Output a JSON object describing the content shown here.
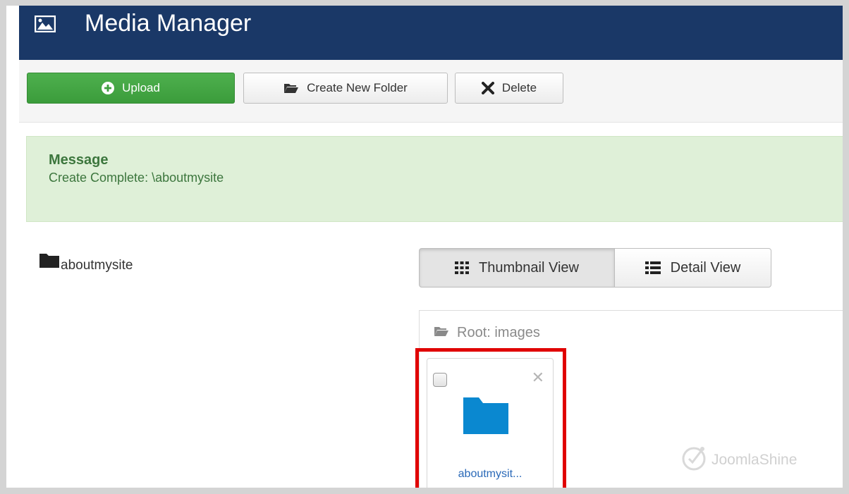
{
  "header": {
    "title": "Media Manager",
    "icon": "image-icon"
  },
  "toolbar": {
    "upload_label": "Upload",
    "create_folder_label": "Create New Folder",
    "delete_label": "Delete"
  },
  "alert": {
    "heading": "Message",
    "text": "Create Complete: \\aboutmysite"
  },
  "folder_tree": {
    "items": [
      {
        "label": "aboutmysite",
        "icon": "folder-icon"
      }
    ]
  },
  "view_toggle": {
    "thumbnail_label": "Thumbnail View",
    "detail_label": "Detail View",
    "active": "thumbnail"
  },
  "media": {
    "breadcrumb": "Root: images",
    "items": [
      {
        "name": "aboutmysit...",
        "type": "folder",
        "checked": false
      }
    ]
  },
  "watermark": {
    "text": "JoomlaShine"
  },
  "colors": {
    "header_bg": "#1a3867",
    "upload_green": "#3b9c3b",
    "alert_bg": "#dff0d8",
    "alert_text": "#3c763d",
    "folder_blue": "#0a88d0",
    "highlight_red": "#e00000",
    "link_blue": "#2a69b8"
  }
}
